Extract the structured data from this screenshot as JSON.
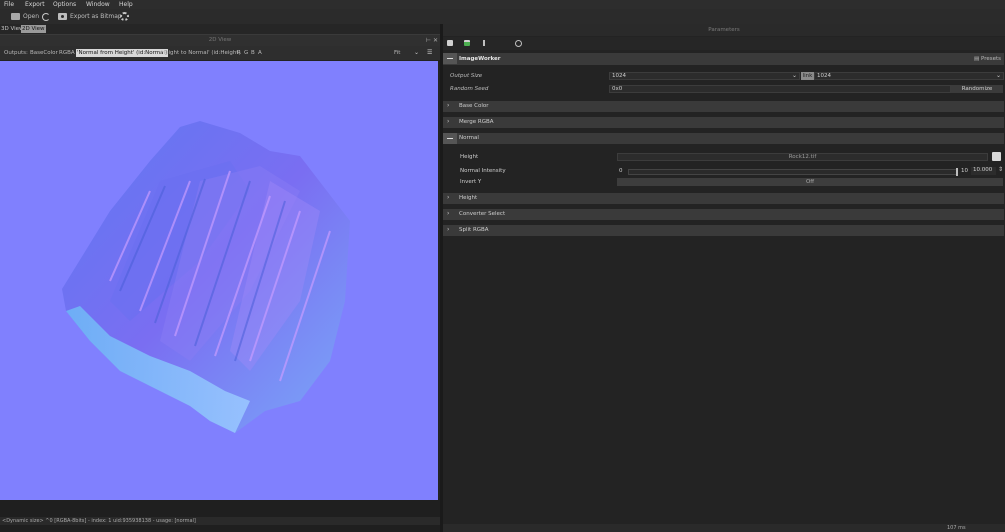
{
  "menu": [
    "File",
    "Export",
    "Options",
    "Window",
    "Help"
  ],
  "toolbar": {
    "open_label": "Open",
    "export_label": "Export as Bitmap"
  },
  "left_panel": {
    "tabs": [
      "3D View",
      "2D View"
    ],
    "title": "2D View",
    "outputs_label": "Outputs:",
    "outputs": [
      "BaseColor",
      "RGBA",
      "'Normal from Height' (id:Normal)",
      "Height to Normal' (id:Height)",
      "R",
      "G",
      "B",
      "A"
    ],
    "selected_output": "'Normal from Height' (id:Normal)",
    "fit_label": "Fit",
    "status": "<Dynamic size> ^0 [RGBA-8bits] - index: 1 uid:935938138 - usage: [normal]",
    "viewport_color": "#8080fe"
  },
  "right_panel": {
    "title": "Parameters",
    "presets_label": "Presets",
    "worker": {
      "name": "ImageWorker",
      "output_size_label": "Output Size",
      "output_size_w": "1024",
      "output_size_h": "1024",
      "link_label": "link",
      "random_seed_label": "Random Seed",
      "random_seed_value": "0x0",
      "randomize_label": "Randomize"
    },
    "sections": [
      "Base Color",
      "Merge RGBA",
      "Normal",
      "Height",
      "Converter Select",
      "Split RGBA"
    ],
    "normal": {
      "height_label": "Height",
      "height_value": "Rock12.tif",
      "intensity_label": "Normal Intensity",
      "intensity_min": "0",
      "intensity_max": "10",
      "intensity_value": "10.000",
      "invert_label": "Invert Y",
      "invert_value": "Off"
    },
    "timing": "107 ms"
  }
}
